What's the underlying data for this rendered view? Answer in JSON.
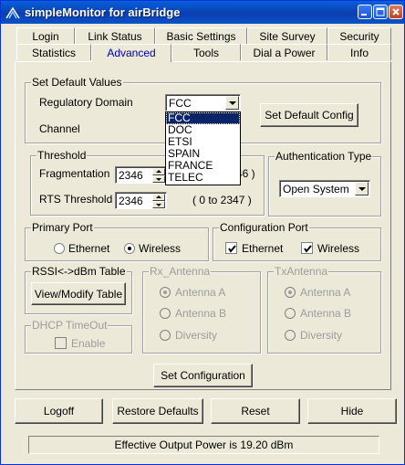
{
  "window": {
    "title": "simpleMonitor for airBridge"
  },
  "tabs_row1": [
    "Login",
    "Link Status",
    "Basic Settings",
    "Site Survey",
    "Security"
  ],
  "tabs_row2": [
    "Statistics",
    "Advanced",
    "Tools",
    "Dial a Power",
    "Info"
  ],
  "active_tab": "Advanced",
  "default_values": {
    "title": "Set Default Values",
    "regulatory_label": "Regulatory Domain",
    "regulatory_value": "FCC",
    "regulatory_options": [
      "FCC",
      "DOC",
      "ETSI",
      "SPAIN",
      "FRANCE",
      "TELEC"
    ],
    "channel_label": "Channel",
    "set_default_button": "Set Default Config"
  },
  "threshold": {
    "title": "Threshold",
    "fragmentation_label": "Fragmentation",
    "fragmentation_value": "2346",
    "fragmentation_range": "46 )",
    "rts_label": "RTS Threshold",
    "rts_value": "2346",
    "rts_range": "( 0 to 2347 )"
  },
  "auth": {
    "title": "Authentication Type",
    "value": "Open System"
  },
  "primary_port": {
    "title": "Primary Port",
    "ethernet": "Ethernet",
    "wireless": "Wireless",
    "selected": "Wireless"
  },
  "config_port": {
    "title": "Configuration Port",
    "ethernet": "Ethernet",
    "wireless": "Wireless",
    "ethernet_checked": true,
    "wireless_checked": true
  },
  "rssi": {
    "title": "RSSI<->dBm Table",
    "button": "View/Modify Table"
  },
  "dhcp": {
    "title": "DHCP TimeOut",
    "enable": "Enable"
  },
  "rx_antenna": {
    "title": "Rx_Antenna",
    "a": "Antenna A",
    "b": "Antenna B",
    "diversity": "Diversity"
  },
  "tx_antenna": {
    "title": "TxAntenna",
    "a": "Antenna A",
    "b": "Antenna B",
    "diversity": "Diversity"
  },
  "set_config_button": "Set Configuration",
  "bottom_buttons": {
    "logoff": "Logoff",
    "restore": "Restore Defaults",
    "reset": "Reset",
    "hide": "Hide"
  },
  "status_text": "Effective Output Power is 19.20 dBm"
}
